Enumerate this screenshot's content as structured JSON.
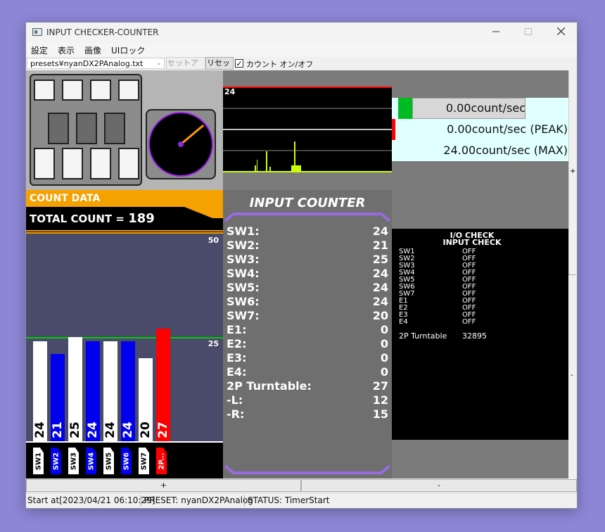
{
  "window": {
    "title": "INPUT CHECKER-COUNTER",
    "controls": {
      "minimize": "minimize-icon",
      "maximize": "maximize-icon",
      "close": "close-icon"
    }
  },
  "menu": [
    "設定",
    "表示",
    "画像",
    "UIロック"
  ],
  "toolbar": {
    "preset_path": "presets¥nyanDX2PAnalog.txt",
    "setup_label": "セットアップ",
    "reset_label": "リセット",
    "count_toggle_label": "カウント オン/オフ",
    "count_toggle_checked": "✓"
  },
  "turntable": {
    "angle_deg": 40,
    "colors": {
      "ring": "#a020f0",
      "needle": "#ff9900",
      "center": "#8a2be2"
    }
  },
  "count_data": {
    "title": "COUNT DATA",
    "total_label": "TOTAL COUNT = ",
    "total_value": "189"
  },
  "bar_chart": {
    "scale_top": "50",
    "scale_mid": "25",
    "max": 50,
    "bars": [
      {
        "label": "SW1",
        "value": 24,
        "color": "#ffffff",
        "text": "#000000",
        "text_str": "24"
      },
      {
        "label": "SW2",
        "value": 21,
        "color": "#0000ee",
        "text": "#ffffff",
        "text_str": "21"
      },
      {
        "label": "SW3",
        "value": 25,
        "color": "#ffffff",
        "text": "#000000",
        "text_str": "25"
      },
      {
        "label": "SW4",
        "value": 24,
        "color": "#0000ee",
        "text": "#ffffff",
        "text_str": "24"
      },
      {
        "label": "SW5",
        "value": 24,
        "color": "#ffffff",
        "text": "#000000",
        "text_str": "24"
      },
      {
        "label": "SW6",
        "value": 24,
        "color": "#0000ee",
        "text": "#ffffff",
        "text_str": "24"
      },
      {
        "label": "SW7",
        "value": 20,
        "color": "#ffffff",
        "text": "#000000",
        "text_str": "20"
      },
      {
        "label": "2P...",
        "value": 27,
        "color": "#ff0000",
        "text": "#ffffff",
        "text_str": "27"
      }
    ]
  },
  "graph": {
    "top_label": "24",
    "colors": {
      "line": "#ccff00",
      "top": "#ff0000"
    }
  },
  "rates": {
    "current": "0.00count/sec",
    "peak": "0.00count/sec (PEAK)",
    "max": "24.00count/sec (MAX)",
    "colors": {
      "indicator_green": "#00bb22",
      "indicator_red": "#ff0000"
    }
  },
  "input_counter": {
    "title": "INPUT COUNTER",
    "rows": [
      {
        "k": "SW1:",
        "v": "24"
      },
      {
        "k": "SW2:",
        "v": "21"
      },
      {
        "k": "SW3:",
        "v": "25"
      },
      {
        "k": "SW4:",
        "v": "24"
      },
      {
        "k": "SW5:",
        "v": "24"
      },
      {
        "k": "SW6:",
        "v": "24"
      },
      {
        "k": "SW7:",
        "v": "20"
      },
      {
        "k": "E1:",
        "v": "0"
      },
      {
        "k": "E2:",
        "v": "0"
      },
      {
        "k": "E3:",
        "v": "0"
      },
      {
        "k": "E4:",
        "v": "0"
      },
      {
        "k": "2P Turntable:",
        "v": "27"
      },
      {
        "k": "-L:",
        "v": "12"
      },
      {
        "k": "-R:",
        "v": "15"
      }
    ]
  },
  "io_check": {
    "title1": "I/O CHECK",
    "title2": "INPUT CHECK",
    "rows": [
      {
        "a": "SW1",
        "b": "OFF"
      },
      {
        "a": "SW2",
        "b": "OFF"
      },
      {
        "a": "SW3",
        "b": "OFF"
      },
      {
        "a": "SW4",
        "b": "OFF"
      },
      {
        "a": "SW5",
        "b": "OFF"
      },
      {
        "a": "SW6",
        "b": "OFF"
      },
      {
        "a": "SW7",
        "b": "OFF"
      },
      {
        "a": "E1",
        "b": "OFF"
      },
      {
        "a": "E2",
        "b": "OFF"
      },
      {
        "a": "E3",
        "b": "OFF"
      },
      {
        "a": "E4",
        "b": "OFF"
      }
    ],
    "turntable_label": "2P Turntable",
    "turntable_value": "32895"
  },
  "scrollbar": {
    "plus": "+",
    "minus": "-"
  },
  "bottom_buttons": {
    "plus": "+",
    "minus": "-"
  },
  "status": {
    "start": "Start at[2023/04/21 06:10:29]",
    "preset": "PRESET:  nyanDX2PAnalog",
    "state": "STATUS:  TimerStart"
  }
}
